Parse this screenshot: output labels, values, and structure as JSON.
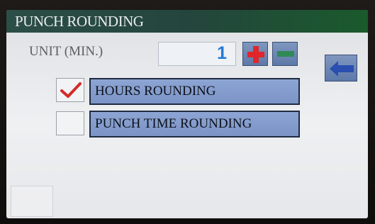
{
  "title": "PUNCH ROUNDING",
  "unit": {
    "label": "UNIT (MIN.)",
    "value": "1",
    "increment_icon": "plus-icon",
    "decrement_icon": "minus-icon"
  },
  "back_button": {
    "icon": "back-arrow-icon"
  },
  "options": [
    {
      "label": "HOURS ROUNDING",
      "checked": true
    },
    {
      "label": "PUNCH TIME ROUNDING",
      "checked": false
    }
  ],
  "colors": {
    "title_bar": "#24453d",
    "button": "#6f88b6",
    "option": "#8aa2d2",
    "value_text": "#2378d8",
    "plus": "#e0262a",
    "minus": "#2f8a55",
    "check": "#d42a2a"
  }
}
